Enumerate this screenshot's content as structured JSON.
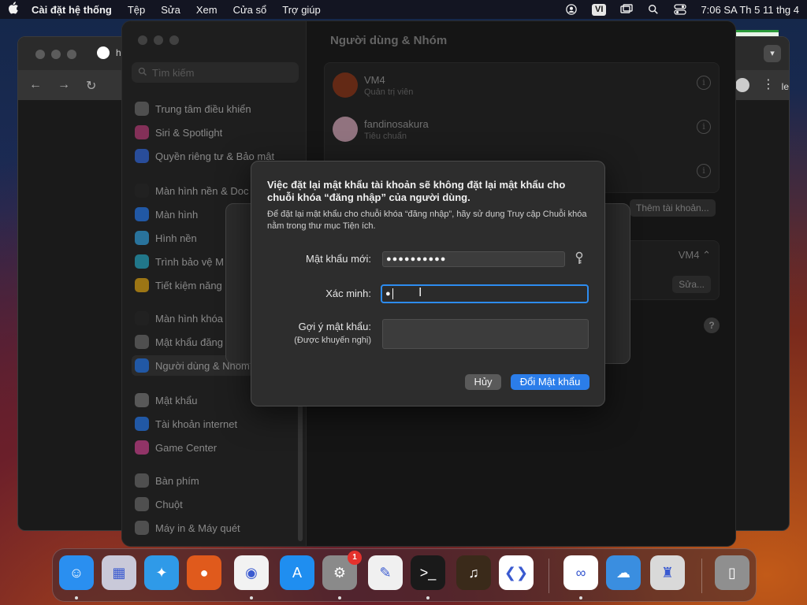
{
  "menubar": {
    "app_name": "Cài đặt hệ thống",
    "items": [
      "Tệp",
      "Sửa",
      "Xem",
      "Cửa sổ",
      "Trợ giúp"
    ],
    "input_source": "VI",
    "clock": "7:06 SA Th 5 11 thg 4"
  },
  "browser": {
    "tab_text": "h",
    "side_text": "le"
  },
  "settings": {
    "search_placeholder": "Tìm kiếm",
    "sidebar": [
      {
        "label": "Trung tâm điều khiển",
        "icon": "control-center-icon",
        "color": "#6e6e6e"
      },
      {
        "label": "Siri & Spotlight",
        "icon": "siri-icon",
        "color": "#b6437a"
      },
      {
        "label": "Quyền riêng tư & Bảo mật",
        "icon": "privacy-hand-icon",
        "color": "#3a6bd6"
      },
      {
        "label": "Màn hình nền & Doc",
        "icon": "desktop-dock-icon",
        "color": "#2f2f2f"
      },
      {
        "label": "Màn hình",
        "icon": "display-sun-icon",
        "color": "#2f7be5"
      },
      {
        "label": "Hình nền",
        "icon": "wallpaper-icon",
        "color": "#3aa0d8"
      },
      {
        "label": "Trình bảo vệ M",
        "icon": "screensaver-icon",
        "color": "#2fa6c0"
      },
      {
        "label": "Tiết kiệm năng",
        "icon": "battery-bulb-icon",
        "color": "#d9a31c"
      },
      {
        "label": "Màn hình khóa",
        "icon": "lock-screen-icon",
        "color": "#2f2f2f"
      },
      {
        "label": "Mật khẩu đăng",
        "icon": "login-password-icon",
        "color": "#6e6e6e"
      },
      {
        "label": "Người dùng & Nhóm",
        "icon": "users-groups-icon",
        "color": "#2f7be5"
      },
      {
        "label": "Mật khẩu",
        "icon": "key-icon",
        "color": "#7a7a7a"
      },
      {
        "label": "Tài khoản internet",
        "icon": "at-sign-icon",
        "color": "#2f7be5"
      },
      {
        "label": "Game Center",
        "icon": "game-center-icon",
        "color": "#c9488f"
      },
      {
        "label": "Bàn phím",
        "icon": "keyboard-icon",
        "color": "#6e6e6e"
      },
      {
        "label": "Chuột",
        "icon": "mouse-icon",
        "color": "#6e6e6e"
      },
      {
        "label": "Máy in & Máy quét",
        "icon": "printer-icon",
        "color": "#6e6e6e"
      }
    ],
    "content_title": "Người dùng & Nhóm",
    "users": [
      {
        "name": "VM4",
        "role": "Quản trị viên",
        "avatar_color": "#8a3a1e"
      },
      {
        "name": "fandinosakura",
        "role": "Tiêu chuẩn",
        "avatar_color": "#c9a0b0"
      }
    ],
    "add_account": "Thêm tài khoản...",
    "auto_login_value": "VM4",
    "edit_button": "Sửa...",
    "help": "?"
  },
  "dialog": {
    "title": "Việc đặt lại mật khẩu tài khoản sẽ không đặt lại mật khẩu cho chuỗi khóa “đăng nhập” của người dùng.",
    "description": "Để đặt lại mật khẩu cho chuỗi khóa “đăng nhập”, hãy sử dụng Truy cập Chuỗi khóa nằm trong thư mục Tiện ích.",
    "new_password_label": "Mật khẩu mới:",
    "new_password_value": "●●●●●●●●●●",
    "verify_label": "Xác minh:",
    "verify_value": "●",
    "hint_label": "Gợi ý mật khẩu:",
    "hint_sub": "(Được khuyến nghị)",
    "cancel": "Hủy",
    "confirm": "Đổi Mật khẩu"
  },
  "dock": {
    "settings_badge": "1",
    "items": [
      {
        "name": "finder-icon",
        "color": "#2a8ff0"
      },
      {
        "name": "launchpad-icon",
        "color": "#c9c9d9"
      },
      {
        "name": "safari-icon",
        "color": "#2f9ae8"
      },
      {
        "name": "firefox-icon",
        "color": "#e05a1c"
      },
      {
        "name": "chrome-icon",
        "color": "#f2f2f2"
      },
      {
        "name": "app-store-icon",
        "color": "#1f8ef0"
      },
      {
        "name": "system-settings-icon",
        "color": "#8a8a8a"
      },
      {
        "name": "textedit-icon",
        "color": "#f0f0f0"
      },
      {
        "name": "terminal-icon",
        "color": "#1a1a1a"
      },
      {
        "name": "garageband-icon",
        "color": "#3a2a1a"
      },
      {
        "name": "vscode-icon",
        "color": "#ffffff"
      },
      {
        "name": "visual-studio-icon",
        "color": "#ffffff"
      },
      {
        "name": "weather-icon",
        "color": "#3a8ee0"
      },
      {
        "name": "automator-icon",
        "color": "#d9d9d9"
      },
      {
        "name": "trash-icon",
        "color": "#8f8f8f"
      }
    ]
  }
}
